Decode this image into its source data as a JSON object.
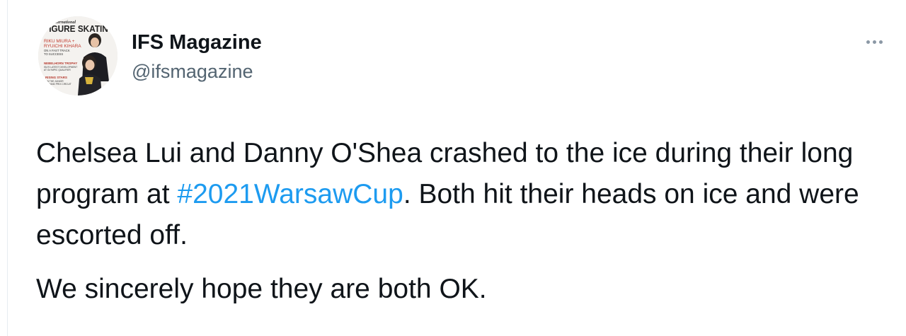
{
  "author": {
    "name": "IFS Magazine",
    "handle": "@ifsmagazine",
    "avatar": {
      "masthead": "FIGURE SKATING",
      "masthead_top": "International",
      "cover_lines": [
        "RIKU MIURA +",
        "RYUICHI KIHARA",
        "ON A FAST TRACK",
        "TO SUCCESS",
        "NEBELHORN TROPHY",
        "ISU'S LATEST DEVELOPMENT",
        "AT OLYMPIC QUALIFIER",
        "RISING STARS",
        "ON THE JUNIOR",
        "GRAND PRIX CIRCUIT"
      ]
    }
  },
  "more_icon": "more-horizontal-icon",
  "tweet": {
    "part1": "Chelsea Lui and Danny O'Shea crashed to the ice during their long program at ",
    "hashtag": "#2021WarsawCup",
    "part2": ". Both hit their heads on ice and were escorted off.",
    "paragraph2": "We sincerely hope they are both OK."
  },
  "colors": {
    "text": "#0f1419",
    "secondary": "#536471",
    "link": "#1d9bf0",
    "more_dots": "#8b98a5"
  }
}
